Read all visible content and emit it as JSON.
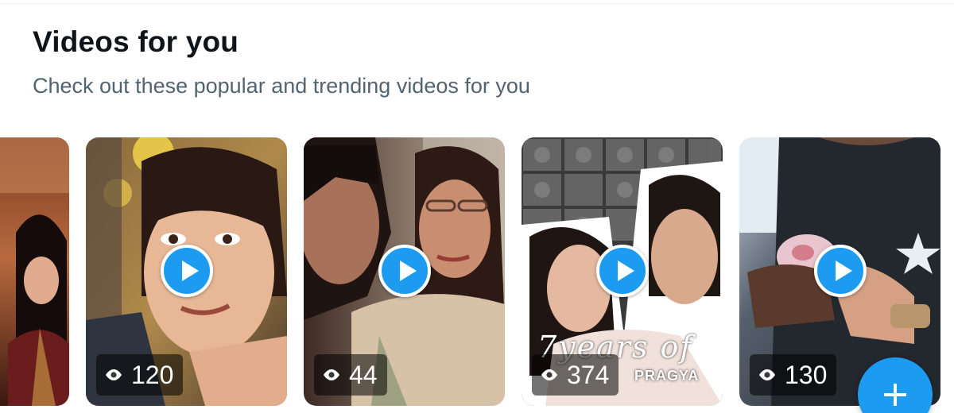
{
  "section": {
    "title": "Videos for you",
    "subtitle": "Check out these popular and trending videos for you"
  },
  "videos": [
    {
      "views": "",
      "thumbnail": "partial-card-woman-saree"
    },
    {
      "views": "120",
      "thumbnail": "woman-closeup-surprised"
    },
    {
      "views": "44",
      "thumbnail": "couple-man-woman-glasses"
    },
    {
      "views": "374",
      "thumbnail": "couple-collage-poster",
      "overlay_text": "7years of",
      "overlay_sub": "PRAGYA"
    },
    {
      "views": "130",
      "thumbnail": "hands-holding-baby-shoes"
    }
  ],
  "icons": {
    "views": "eye-icon",
    "play": "play-icon",
    "compose": "plus-icon"
  },
  "colors": {
    "accent": "#1d9bf0",
    "title": "#0f1419",
    "subtitle": "#536471"
  }
}
